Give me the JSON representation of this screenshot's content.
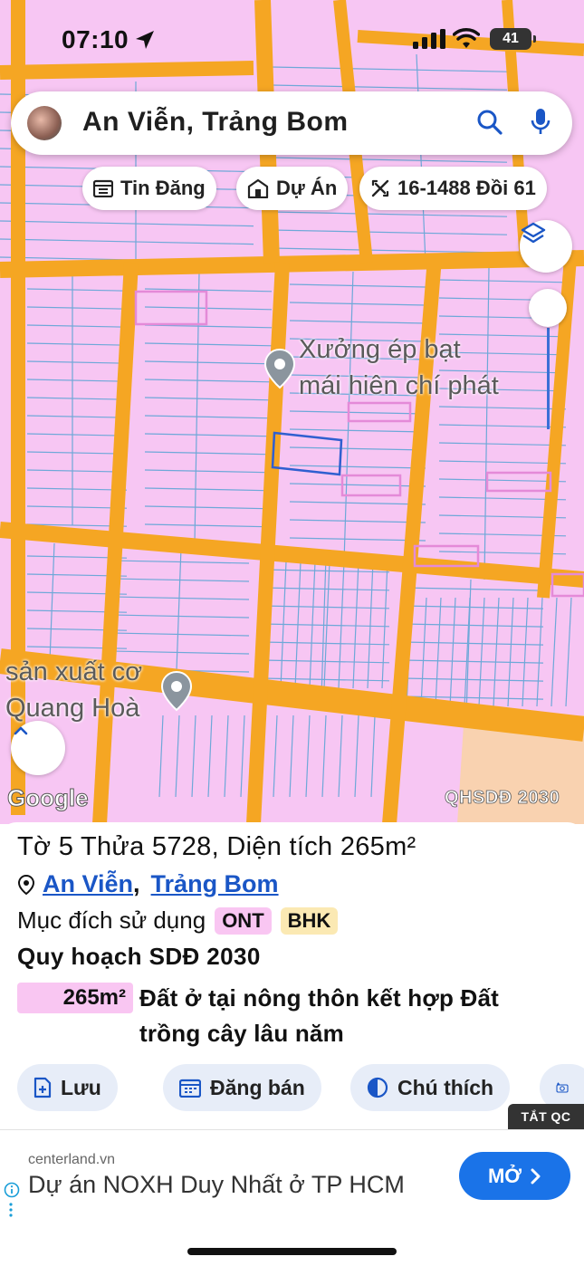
{
  "status_bar": {
    "time": "07:10",
    "battery": "41"
  },
  "search": {
    "query": "An Viễn, Trảng Bom"
  },
  "chips": [
    {
      "label": "Tin Đăng",
      "icon": "calendar-list-icon"
    },
    {
      "label": "Dự Án",
      "icon": "building-icon"
    },
    {
      "label": "16-1488 Đồi 61",
      "icon": "ruler-icon"
    }
  ],
  "map": {
    "labels": {
      "poi_1_line1": "Xưởng ép bạt",
      "poi_1_line2": "mái hiên chí phát",
      "poi_2_line1": "sản xuất cơ",
      "poi_2_line2": "Quang Hoà"
    },
    "google": "Google",
    "layer_tag": "QHSDĐ 2030",
    "colors": {
      "residential": "#f7c6f3",
      "road": "#f5a623",
      "parcel_line": "#6ea8d8",
      "agri": "#f9d2b0",
      "selection": "#2f5fd0"
    }
  },
  "panel": {
    "title": "Tờ 5 Thửa 5728, Diện tích 265m²",
    "location_commune": "An Viễn",
    "location_district": "Trảng Bom",
    "purpose_label": "Mục đích sử dụng",
    "badge_1": "ONT",
    "badge_2": "BHK",
    "plan_title": "Quy hoạch SDĐ 2030",
    "area": "265m²",
    "land_desc": "Đất ở tại nông thôn kết hợp Đất trồng cây lâu năm",
    "actions": {
      "save": "Lưu",
      "post": "Đăng bán",
      "legend": "Chú thích"
    }
  },
  "ad": {
    "close_label": "TẮT QC",
    "domain": "centerland.vn",
    "headline": "Dự án NOXH Duy Nhất ở TP HCM",
    "open_label": "MỞ"
  }
}
